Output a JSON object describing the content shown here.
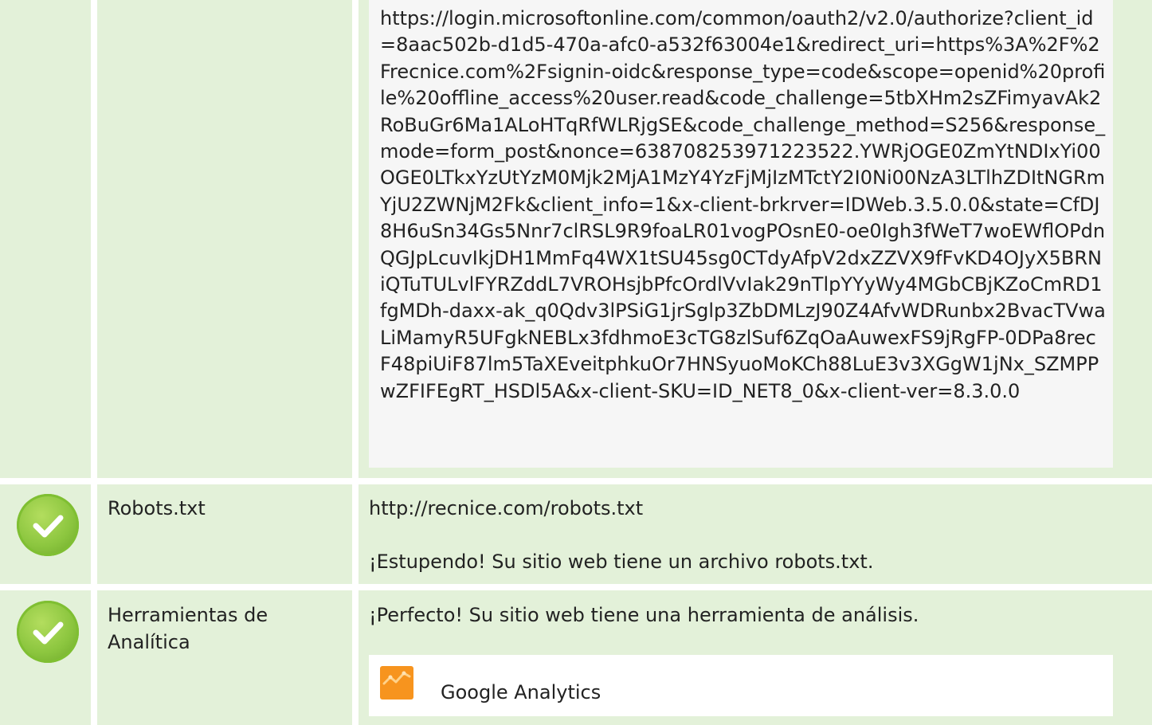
{
  "rows": [
    {
      "status": "pass",
      "redirect_url": "https://login.microsoftonline.com/common/oauth2/v2.0/authorize?client_id=8aac502b-d1d5-470a-afc0-a532f63004e1&redirect_uri=https%3A%2F%2Frecnice.com%2Fsignin-oidc&response_type=code&scope=openid%20profile%20offline_access%20user.read&code_challenge=5tbXHm2sZFimyavAk2RoBuGr6Ma1ALoHTqRfWLRjgSE&code_challenge_method=S256&response_mode=form_post&nonce=638708253971223522.YWRjOGE0ZmYtNDIxYi00OGE0LTkxYzUtYzM0Mjk2MjA1MzY4YzFjMjIzMTctY2I0Ni00NzA3LTlhZDItNGRmYjU2ZWNjM2Fk&client_info=1&x-client-brkrver=IDWeb.3.5.0.0&state=CfDJ8H6uSn34Gs5Nnr7clRSL9R9foaLR01vogPOsnE0-oe0Igh3fWeT7woEWflOPdnQGJpLcuvIkjDH1MmFq4WX1tSU45sg0CTdyAfpV2dxZZVX9fFvKD4OJyX5BRNiQTuTULvlFYRZddL7VROHsjbPfcOrdlVvIak29nTlpYYyWy4MGbCBjKZoCmRD1fgMDh-daxx-ak_q0Qdv3lPSiG1jrSglp3ZbDMLzJ90Z4AfvWDRunbx2BvacTVwaLiMamyR5UFgkNEBLx3fdhmoE3cTG8zlSuf6ZqOaAuwexFS9jRgFP-0DPa8recF48piUiF87lm5TaXEveitphkuOr7HNSyuoMoKCh88LuE3v3XGgW1jNx_SZMPPwZFIFEgRT_HSDl5A&x-client-SKU=ID_NET8_0&x-client-ver=8.3.0.0"
    },
    {
      "status": "pass",
      "label": "Robots.txt",
      "url": "http://recnice.com/robots.txt",
      "message": "¡Estupendo! Su sitio web tiene un archivo robots.txt."
    },
    {
      "status": "pass",
      "label": "Herramientas de Analítica",
      "message": "¡Perfecto! Su sitio web tiene una herramienta de análisis.",
      "tools": [
        {
          "name": "Google Analytics",
          "icon": "google-analytics-icon"
        }
      ]
    }
  ],
  "colors": {
    "row_background": "#e3f1d9",
    "check_green": "#8cc63f",
    "url_box_background": "#f6f6f6",
    "analytics_orange": "#f7941e"
  }
}
